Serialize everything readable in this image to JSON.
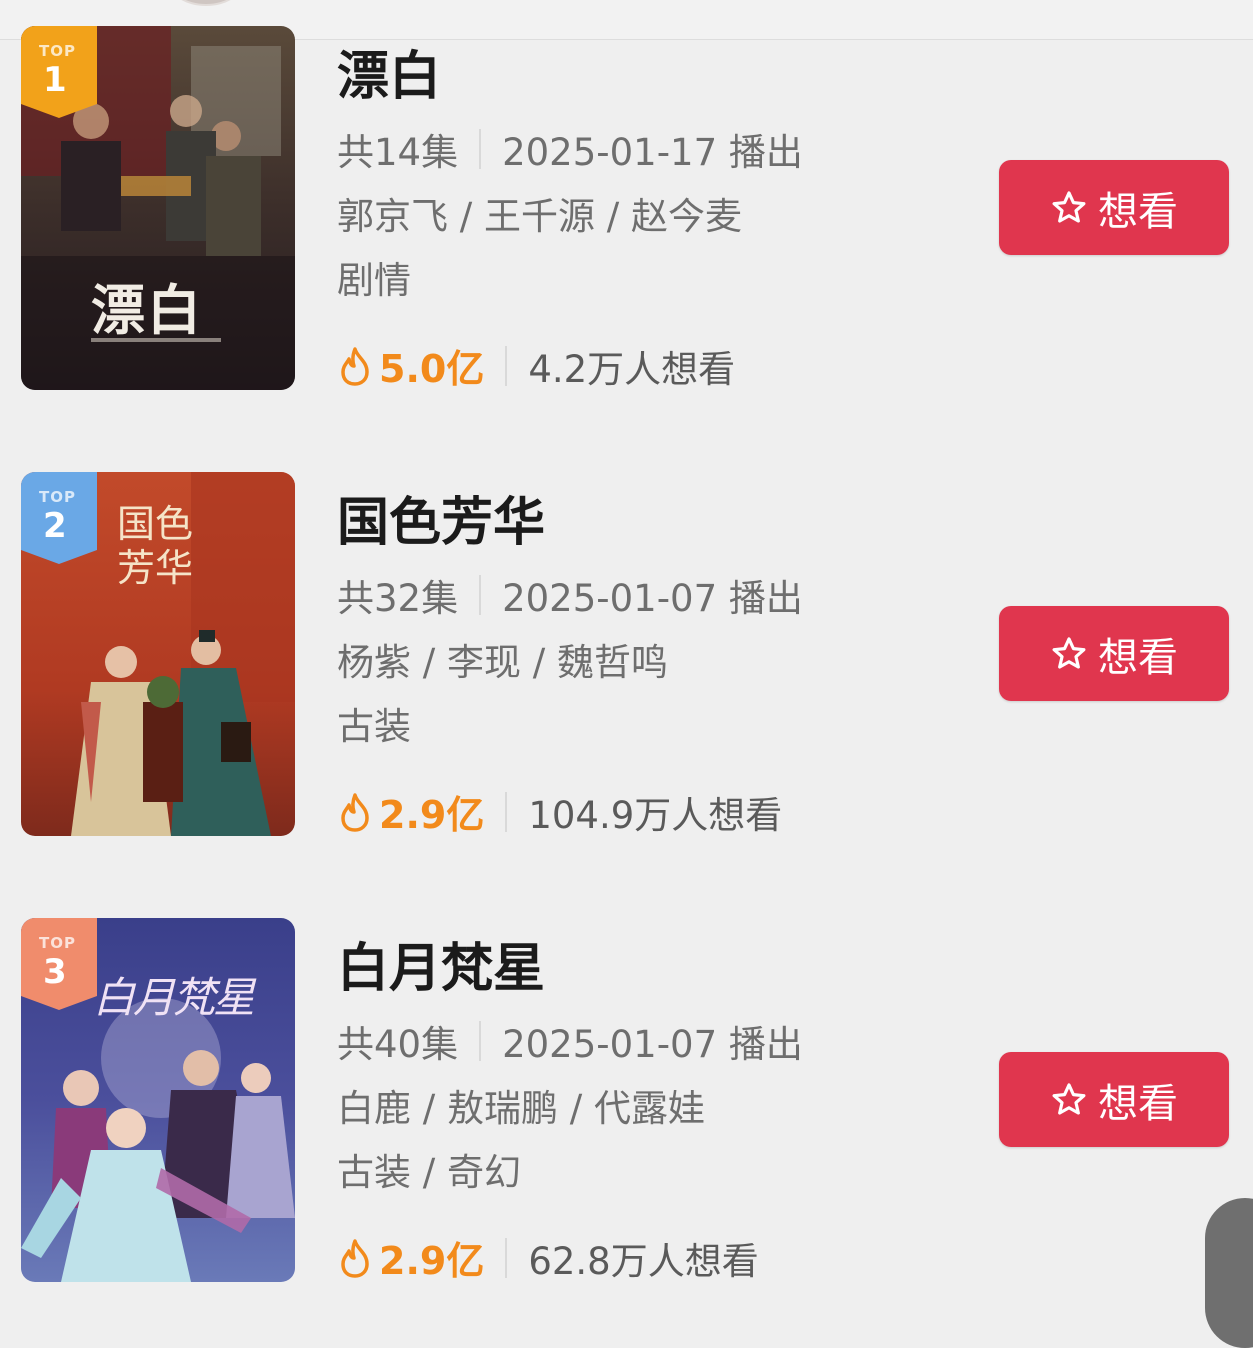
{
  "colors": {
    "accent_red": "#e0364e",
    "heat_orange": "#f28a1b",
    "rank1_badge": "#f2a21a",
    "rank2_badge": "#6aa8e6",
    "rank3_badge": "#f08c6c"
  },
  "list": {
    "items": [
      {
        "rank_top": "TOP",
        "rank": "1",
        "poster_title": "漂白",
        "title": "漂白",
        "episodes": "共14集",
        "air_date": "2025-01-17 播出",
        "cast": "郭京飞 / 王千源 / 赵今麦",
        "genre": "剧情",
        "heat": "5.0亿",
        "want_count": "4.2万人想看",
        "want_label": "想看"
      },
      {
        "rank_top": "TOP",
        "rank": "2",
        "poster_title": "国色芳华",
        "title": "国色芳华",
        "episodes": "共32集",
        "air_date": "2025-01-07 播出",
        "cast": "杨紫 / 李现 / 魏哲鸣",
        "genre": "古装",
        "heat": "2.9亿",
        "want_count": "104.9万人想看",
        "want_label": "想看"
      },
      {
        "rank_top": "TOP",
        "rank": "3",
        "poster_title": "白月梵星",
        "title": "白月梵星",
        "episodes": "共40集",
        "air_date": "2025-01-07 播出",
        "cast": "白鹿 / 敖瑞鹏 / 代露娃",
        "genre": "古装 / 奇幻",
        "heat": "2.9亿",
        "want_count": "62.8万人想看",
        "want_label": "想看"
      }
    ]
  }
}
